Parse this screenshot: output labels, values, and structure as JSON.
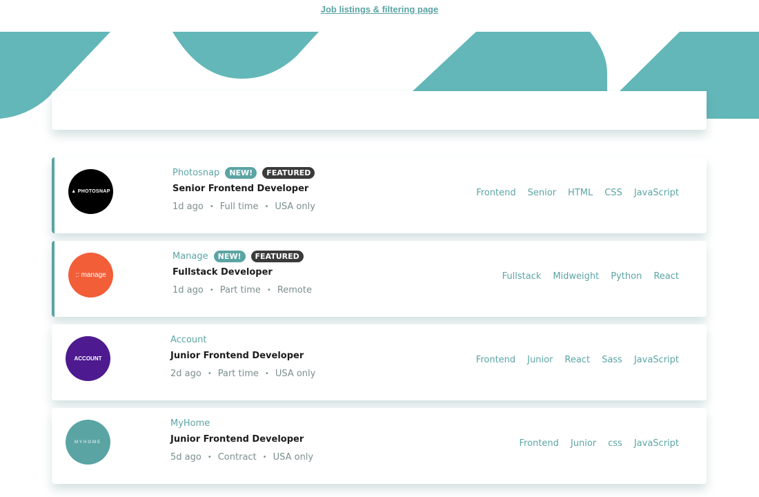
{
  "header": {
    "link_text": "Job listings & filtering page"
  },
  "colors": {
    "accent": "#5ba4a4",
    "dark_badge": "#3b3b3b",
    "hero": "#63b7b8"
  },
  "jobs": [
    {
      "company": "Photosnap",
      "new_label": "NEW!",
      "featured_label": "FEATURED",
      "position": "Senior Frontend Developer",
      "posted": "1d ago",
      "contract": "Full time",
      "location": "USA only",
      "logo_text": "▲ PHOTOSNAP",
      "logo_bg": "#000000",
      "tags": [
        "Frontend",
        "Senior",
        "HTML",
        "CSS",
        "JavaScript"
      ]
    },
    {
      "company": "Manage",
      "new_label": "NEW!",
      "featured_label": "FEATURED",
      "position": "Fullstack Developer",
      "posted": "1d ago",
      "contract": "Part time",
      "location": "Remote",
      "logo_text": ":: manage",
      "logo_bg": "#f15e38",
      "tags": [
        "Fullstack",
        "Midweight",
        "Python",
        "React"
      ]
    },
    {
      "company": "Account",
      "position": "Junior Frontend Developer",
      "posted": "2d ago",
      "contract": "Part time",
      "location": "USA only",
      "logo_text": "ACCOUNT",
      "logo_bg": "#4d1a8f",
      "tags": [
        "Frontend",
        "Junior",
        "React",
        "Sass",
        "JavaScript"
      ]
    },
    {
      "company": "MyHome",
      "position": "Junior Frontend Developer",
      "posted": "5d ago",
      "contract": "Contract",
      "location": "USA only",
      "logo_text": "MYHOME",
      "logo_bg": "#5ba4a4",
      "tags": [
        "Frontend",
        "Junior",
        "css",
        "JavaScript"
      ]
    }
  ],
  "separator": "•"
}
